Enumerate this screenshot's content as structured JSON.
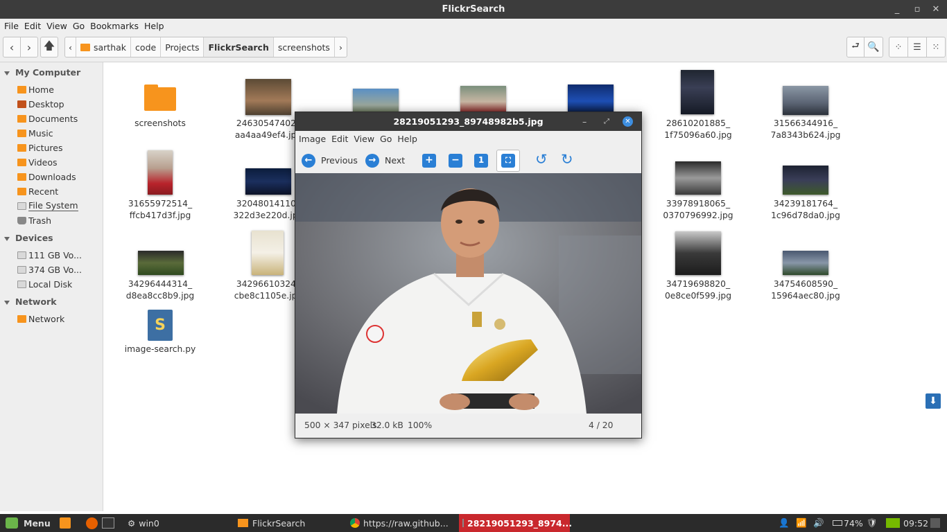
{
  "window": {
    "title": "FlickrSearch"
  },
  "menubar": [
    "File",
    "Edit",
    "View",
    "Go",
    "Bookmarks",
    "Help"
  ],
  "breadcrumb": [
    "sarthak",
    "code",
    "Projects",
    "FlickrSearch",
    "screenshots"
  ],
  "sidebar": {
    "sections": [
      {
        "title": "My Computer",
        "items": [
          "Home",
          "Desktop",
          "Documents",
          "Music",
          "Pictures",
          "Videos",
          "Downloads",
          "Recent",
          "File System",
          "Trash"
        ]
      },
      {
        "title": "Devices",
        "items": [
          "111 GB Vo...",
          "374 GB Vo...",
          "Local Disk"
        ]
      },
      {
        "title": "Network",
        "items": [
          "Network"
        ]
      }
    ]
  },
  "files": [
    {
      "name1": "screenshots",
      "name2": ""
    },
    {
      "name1": "24630547402_",
      "name2": "aa4aa49ef4.jpg"
    },
    {
      "name1": "28610201885_",
      "name2": "1f75096a60.jpg"
    },
    {
      "name1": "31566344916_",
      "name2": "7a8343b624.jpg"
    },
    {
      "name1": "31655972514_",
      "name2": "ffcb417d3f.jpg"
    },
    {
      "name1": "32048014110_",
      "name2": "322d3e220d.jpg"
    },
    {
      "name1": "33978918065_",
      "name2": "0370796992.jpg"
    },
    {
      "name1": "34239181764_",
      "name2": "1c96d78da0.jpg"
    },
    {
      "name1": "34296444314_",
      "name2": "d8ea8cc8b9.jpg"
    },
    {
      "name1": "34296610324_",
      "name2": "cbe8c1105e.jpg"
    },
    {
      "name1": "34719698820_",
      "name2": "0e8ce0f599.jpg"
    },
    {
      "name1": "34754608590_",
      "name2": "15964aec80.jpg"
    },
    {
      "name1": "image-search.py",
      "name2": ""
    }
  ],
  "viewer": {
    "title": "28219051293_89748982b5.jpg",
    "menu": [
      "Image",
      "Edit",
      "View",
      "Go",
      "Help"
    ],
    "previous_label": "Previous",
    "next_label": "Next",
    "status_dims": "500 × 347 pixels",
    "status_size": "32.0 kB",
    "status_zoom": "100%",
    "status_index": "4 / 20"
  },
  "taskbar": {
    "menu_label": "Menu",
    "win0": "win0",
    "file_manager": "FlickrSearch",
    "browser": "https://raw.github...",
    "viewer": "28219051293_8974...",
    "battery": "74%",
    "clock": "09:52"
  },
  "colors": {
    "folder": "#f7941d",
    "accent": "#2a7fd5",
    "taskbar_active": "#c9282d"
  }
}
